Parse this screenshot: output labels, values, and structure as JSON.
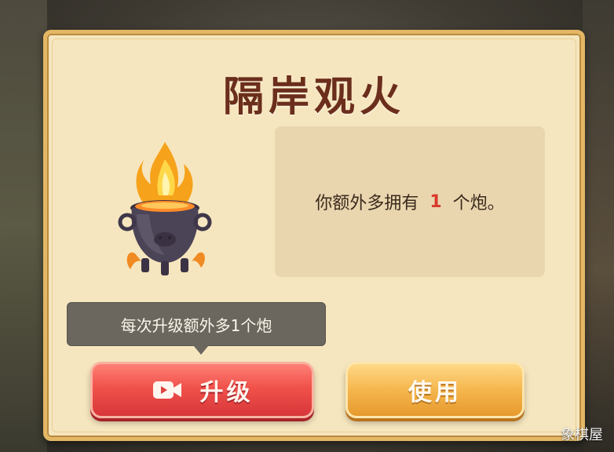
{
  "dialog": {
    "title": "隔岸观火",
    "description_prefix": "你额外多拥有",
    "extra_count": "1",
    "description_suffix": "个炮。",
    "tooltip": "每次升级额外多1个炮",
    "upgrade_label": "升级",
    "use_label": "使用"
  },
  "icons": {
    "item": "fire-cauldron-icon",
    "video": "video-camera-icon"
  },
  "colors": {
    "title": "#6b2e1c",
    "highlight_number": "#d8392b",
    "upgrade_button": "#e8473f",
    "use_button": "#f2b049"
  },
  "watermark": "象棋屋"
}
